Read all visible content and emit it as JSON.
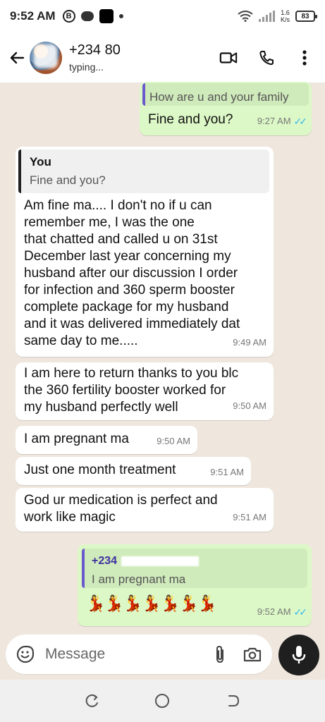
{
  "status_bar": {
    "time": "9:52 AM",
    "b_badge": "B",
    "net_speed_value": "1.6",
    "net_speed_unit": "K/s",
    "battery": "83"
  },
  "header": {
    "contact_name": "+234 80",
    "status": "typing..."
  },
  "messages": [
    {
      "direction": "out",
      "quoted_text": "How are u and your family",
      "text": "Fine and you?",
      "time": "9:27 AM",
      "read": true
    },
    {
      "direction": "in",
      "quote_author": "You",
      "quoted_text": "Fine and you?",
      "lines": [
        "Am fine ma.... I don't no if u can",
        "remember me, I was the one",
        "that chatted and called u on 31st",
        "December last year concerning my",
        "husband after our discussion I order",
        "for infection and 360 sperm booster",
        "complete package for my husband",
        "and it was delivered immediately dat",
        "same day to me....."
      ],
      "time": "9:49 AM"
    },
    {
      "direction": "in",
      "lines": [
        "I am here to return thanks to you blc",
        "the 360 fertility booster worked for",
        "my husband perfectly well"
      ],
      "time": "9:50 AM"
    },
    {
      "direction": "in",
      "text": "I am pregnant ma",
      "time": "9:50 AM"
    },
    {
      "direction": "in",
      "text": "Just one month treatment",
      "time": "9:51 AM"
    },
    {
      "direction": "in",
      "lines": [
        "God ur medication is perfect and",
        "work like magic"
      ],
      "time": "9:51 AM"
    },
    {
      "direction": "out",
      "quote_author": "+234",
      "quoted_text": "I am pregnant ma",
      "emoji_text": "💃💃💃💃💃💃💃",
      "time": "9:52 AM",
      "read": true
    }
  ],
  "input": {
    "placeholder": "Message"
  },
  "colors": {
    "chat_bg": "#efe7dd",
    "outgoing_bubble": "#dcf8c6",
    "incoming_bubble": "#ffffff",
    "read_ticks": "#34b7f1",
    "mic_button": "#1f1f1f"
  }
}
